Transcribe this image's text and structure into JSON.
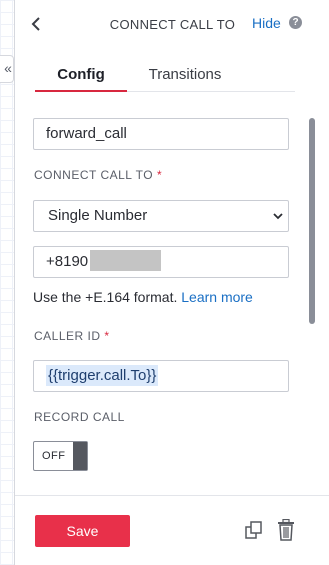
{
  "header": {
    "title": "CONNECT CALL TO",
    "hide_label": "Hide",
    "help_glyph": "?"
  },
  "collapse": {
    "glyph": "«"
  },
  "tabs": [
    {
      "label": "Config",
      "active": true
    },
    {
      "label": "Transitions",
      "active": false
    }
  ],
  "form": {
    "widget_name": "forward_call",
    "connect_call_to": {
      "label": "CONNECT CALL TO",
      "required_mark": "*",
      "selected": "Single Number",
      "phone_value": "+8190",
      "hint_text": "Use the +E.164 format.",
      "hint_link": "Learn more"
    },
    "caller_id": {
      "label": "CALLER ID",
      "required_mark": "*",
      "value": "{{trigger.call.To}}"
    },
    "record_call": {
      "label": "RECORD CALL",
      "toggle_state": "OFF"
    }
  },
  "footer": {
    "save_label": "Save"
  },
  "colors": {
    "accent": "#e8304a",
    "link": "#1a6fc4",
    "tab_underline": "#d8283f"
  },
  "icons": [
    "back-chevron-icon",
    "help-icon",
    "chevron-down-icon",
    "duplicate-icon",
    "trash-icon",
    "collapse-icon"
  ]
}
